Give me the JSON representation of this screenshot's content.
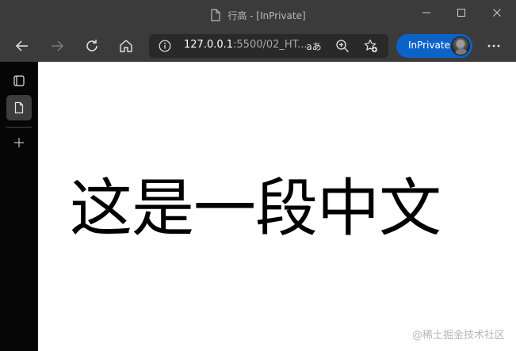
{
  "titlebar": {
    "title": "行高 - [InPrivate]",
    "page_icon": "document-icon",
    "controls": [
      "minimize-icon",
      "maximize-icon",
      "close-icon"
    ]
  },
  "toolbar": {
    "buttons": [
      "back-arrow-icon",
      "forward-arrow-icon",
      "refresh-icon",
      "home-icon"
    ],
    "address": {
      "host": "127.0.0.1",
      "rest": ":5500/02_HT..."
    },
    "read_aloud_label": "aあ",
    "inprivate_label": "InPrivate"
  },
  "sidebar": {
    "items": [
      "tab-actions-icon",
      "page-icon",
      "add-icon"
    ]
  },
  "content": {
    "heading": "这是一段中文",
    "watermark": "@稀土掘金技术社区"
  },
  "colors": {
    "chrome": "#3b3b3b",
    "address_bar": "#292929",
    "inprivate": "#0b63c8",
    "sidebar": "#060606",
    "page": "#ffffff"
  }
}
